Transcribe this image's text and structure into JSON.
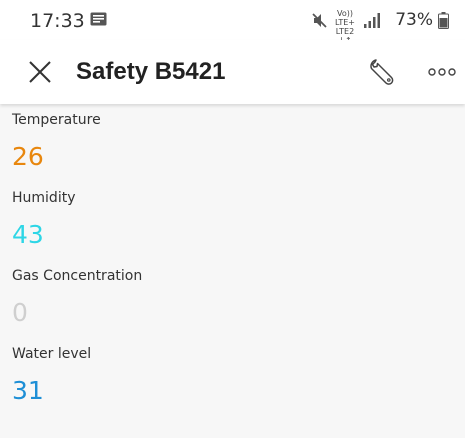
{
  "status_bar": {
    "time": "17:33",
    "volte_top": "Vo)) LTE+",
    "volte_bottom": "LTE2 ↓↑",
    "battery": "73%"
  },
  "header": {
    "title": "Safety B5421"
  },
  "metrics": [
    {
      "label": "Temperature",
      "value": "26",
      "color": "#e8870e"
    },
    {
      "label": "Humidity",
      "value": "43",
      "color": "#2ed6e6"
    },
    {
      "label": "Gas Concentration",
      "value": "0",
      "color": "#cfcfcf"
    },
    {
      "label": "Water level",
      "value": "31",
      "color": "#1e8fd6"
    }
  ],
  "icons": {
    "status_msg": "message-icon",
    "mute": "mute-icon",
    "signal": "signal-icon",
    "battery": "battery-icon",
    "close": "close-icon",
    "settings": "wrench-icon",
    "more": "more-icon"
  }
}
